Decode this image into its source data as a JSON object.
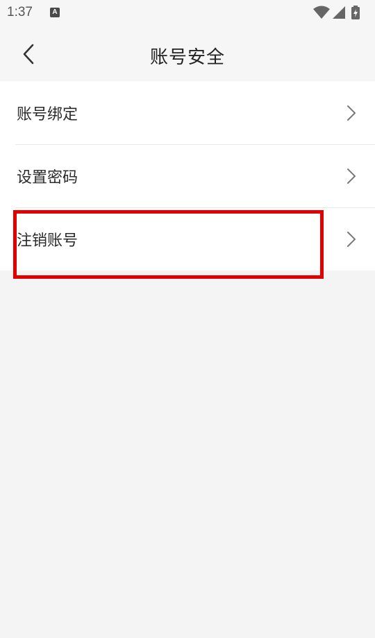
{
  "status_bar": {
    "time": "1:37",
    "notification_icon_letter": "A",
    "icons": [
      "wifi-icon",
      "signal-icon",
      "battery-icon"
    ]
  },
  "header": {
    "title": "账号安全",
    "back_icon": "chevron-left-icon"
  },
  "settings": {
    "items": [
      {
        "label": "账号绑定",
        "icon": "chevron-right-icon"
      },
      {
        "label": "设置密码",
        "icon": "chevron-right-icon"
      },
      {
        "label": "注销账号",
        "icon": "chevron-right-icon"
      }
    ]
  },
  "colors": {
    "highlight": "#e00000",
    "background": "#f4f4f4",
    "header_background": "#f6f6f7"
  }
}
